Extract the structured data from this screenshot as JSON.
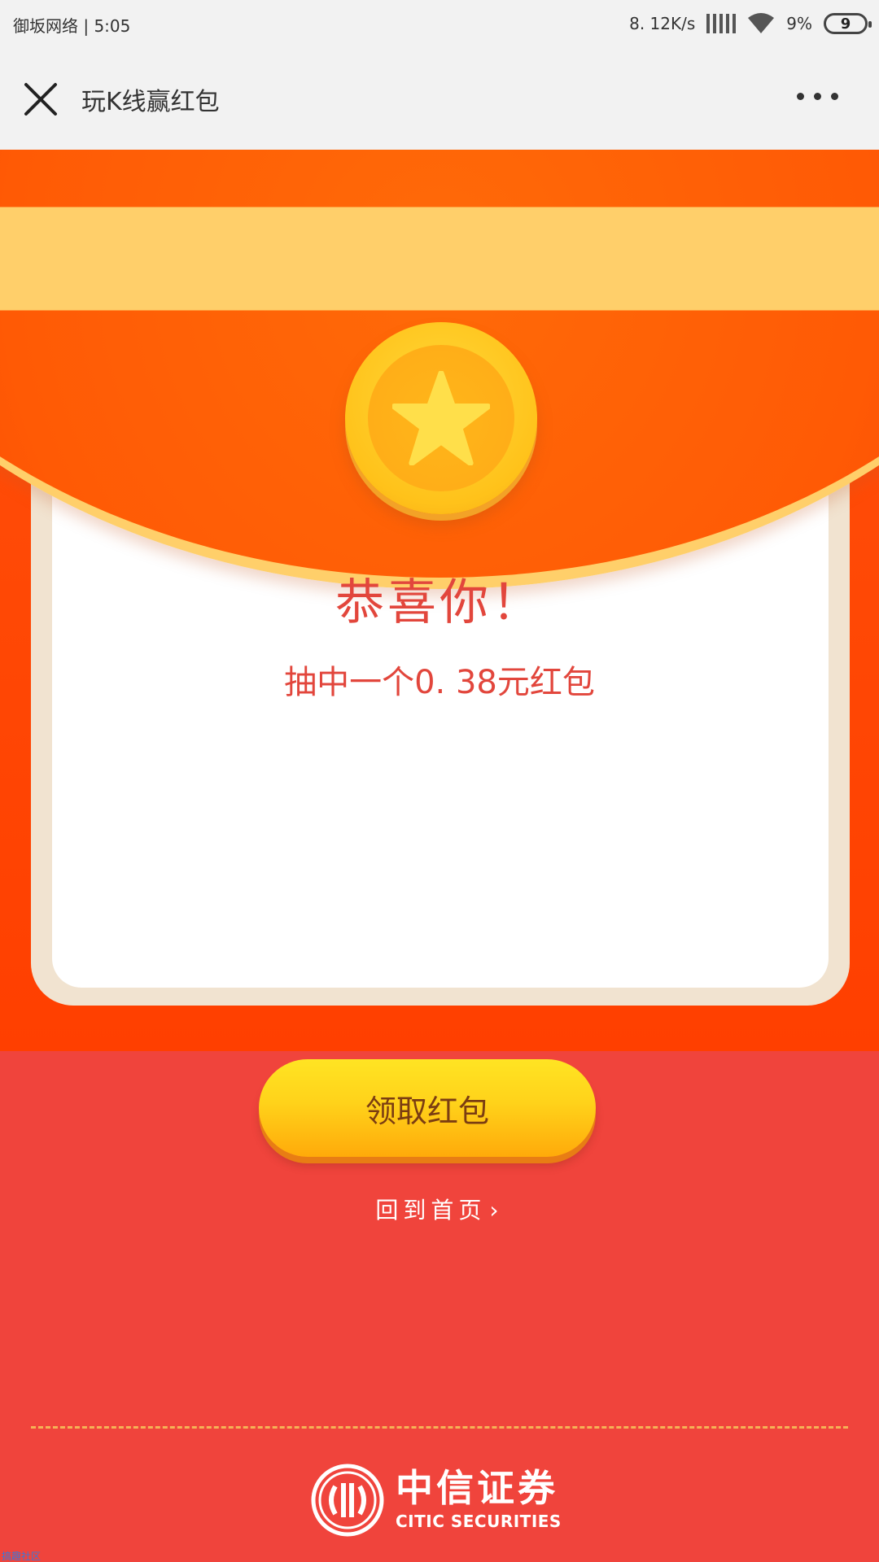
{
  "status_bar": {
    "carrier_time": "御坂网络 | 5:05",
    "net_speed": "8. 12K/s",
    "battery_percent": "9%",
    "battery_level": "9"
  },
  "nav": {
    "title": "玩K线赢红包"
  },
  "result": {
    "congrats": "恭喜你！",
    "prize": "抽中一个0. 38元红包"
  },
  "actions": {
    "claim_label": "领取红包",
    "home_label": "回到首页",
    "home_chevron": "›"
  },
  "brand": {
    "name_cn": "中信证券",
    "name_en": "CITIC SECURITIES"
  },
  "watermark": "搞趣社区",
  "colors": {
    "accent_red": "#e2463c",
    "envelope_orange": "#ff4a06",
    "button_yellow": "#ffd21a",
    "page_red": "#f0443c"
  }
}
